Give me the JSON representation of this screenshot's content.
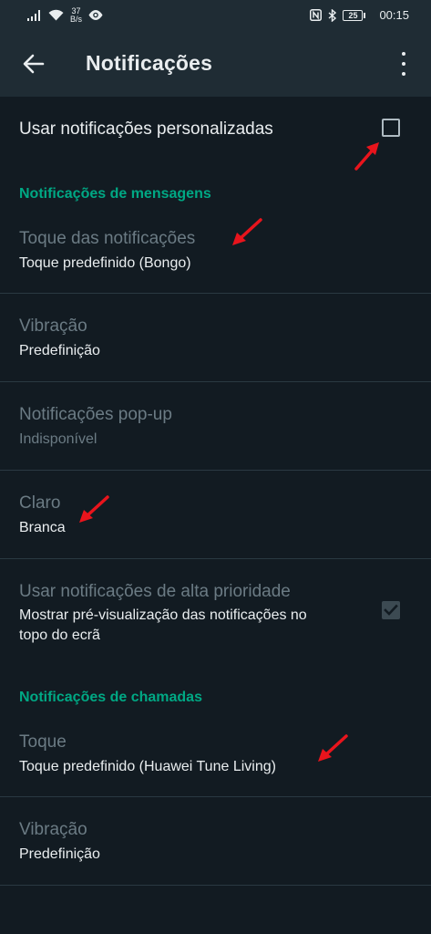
{
  "status": {
    "speed_value": "37",
    "speed_unit": "B/s",
    "battery": "25",
    "time": "00:15",
    "nfc_label": "N"
  },
  "header": {
    "title": "Notificações"
  },
  "custom": {
    "label": "Usar notificações personalizadas",
    "checked": false
  },
  "sections": {
    "messages": "Notificações de mensagens",
    "calls": "Notificações de chamadas"
  },
  "messages": {
    "tone_title": "Toque das notificações",
    "tone_value": "Toque predefinido (Bongo)",
    "vibration_title": "Vibração",
    "vibration_value": "Predefinição",
    "popup_title": "Notificações pop-up",
    "popup_value": "Indisponível",
    "light_title": "Claro",
    "light_value": "Branca",
    "priority_title": "Usar notificações de alta prioridade",
    "priority_value_line1": "Mostrar pré-visualização das notificações no",
    "priority_value_line2": "topo do ecrã",
    "priority_checked": true
  },
  "calls": {
    "tone_title": "Toque",
    "tone_value": "Toque predefinido (Huawei Tune Living)",
    "vibration_title": "Vibração",
    "vibration_value": "Predefinição"
  },
  "colors": {
    "background": "#121b22",
    "bar": "#1f2c34",
    "accent": "#00a884",
    "annotation_arrow": "#e8141c"
  },
  "icons": [
    "signal-icon",
    "wifi-icon",
    "eye-icon",
    "nfc-icon",
    "bluetooth-icon",
    "battery-icon",
    "back-arrow-icon",
    "more-vert-icon",
    "checkbox-icon",
    "annotation-arrow-icon"
  ]
}
